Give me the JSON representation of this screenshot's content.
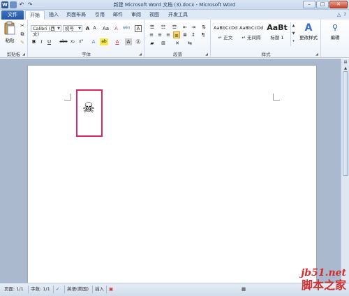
{
  "window": {
    "title": "新建 Microsoft Word 文档 (3).docx - Microsoft Word",
    "controls": {
      "minimize": "–",
      "maximize": "□",
      "close": "✕"
    }
  },
  "quick_access": {
    "word_icon": "W",
    "undo": "↶",
    "redo": "↷"
  },
  "tabs": [
    {
      "label": "文件"
    },
    {
      "label": "开始"
    },
    {
      "label": "插入"
    },
    {
      "label": "页面布局"
    },
    {
      "label": "引用"
    },
    {
      "label": "邮件"
    },
    {
      "label": "审阅"
    },
    {
      "label": "视图"
    },
    {
      "label": "开发工具"
    }
  ],
  "tab_icons": {
    "help": "?",
    "collapse": "△"
  },
  "ribbon": {
    "clipboard": {
      "paste_label": "粘贴",
      "group_label": "剪贴板"
    },
    "font": {
      "font_name": "Calibri (西文)",
      "font_size": "初号",
      "grow": "A",
      "shrink": "A",
      "case": "Aa",
      "clear": "A",
      "wen": "wén",
      "border_a": "A",
      "bold": "B",
      "italic": "I",
      "underline": "U",
      "strike": "abe",
      "sub": "x₂",
      "sup": "x²",
      "effects": "A",
      "highlight": "ab",
      "color": "A",
      "shade": "A",
      "circle": "Ⓐ",
      "group_label": "字体"
    },
    "paragraph": {
      "group_label": "段落"
    },
    "styles": {
      "items": [
        {
          "sample": "AaBbCcDd",
          "name": "↵ 正文"
        },
        {
          "sample": "AaBbCcDd",
          "name": "↵ 无间隔"
        },
        {
          "sample": "AaBt",
          "name": "标题 1"
        }
      ],
      "change_styles": "更改样式",
      "group_label": "样式"
    },
    "editing": {
      "label": "编辑"
    }
  },
  "document": {
    "symbol": "☠"
  },
  "status": {
    "page": "页面: 1/1",
    "words": "字数: 1/1",
    "language": "英语(美国)",
    "mode": "插入"
  },
  "watermark": {
    "url": "jb51.net",
    "text": "脚本之家"
  },
  "colors": {
    "file_tab": "#2b5797",
    "highlight_box": "#e0255e",
    "watermark": "#d12f2f"
  }
}
